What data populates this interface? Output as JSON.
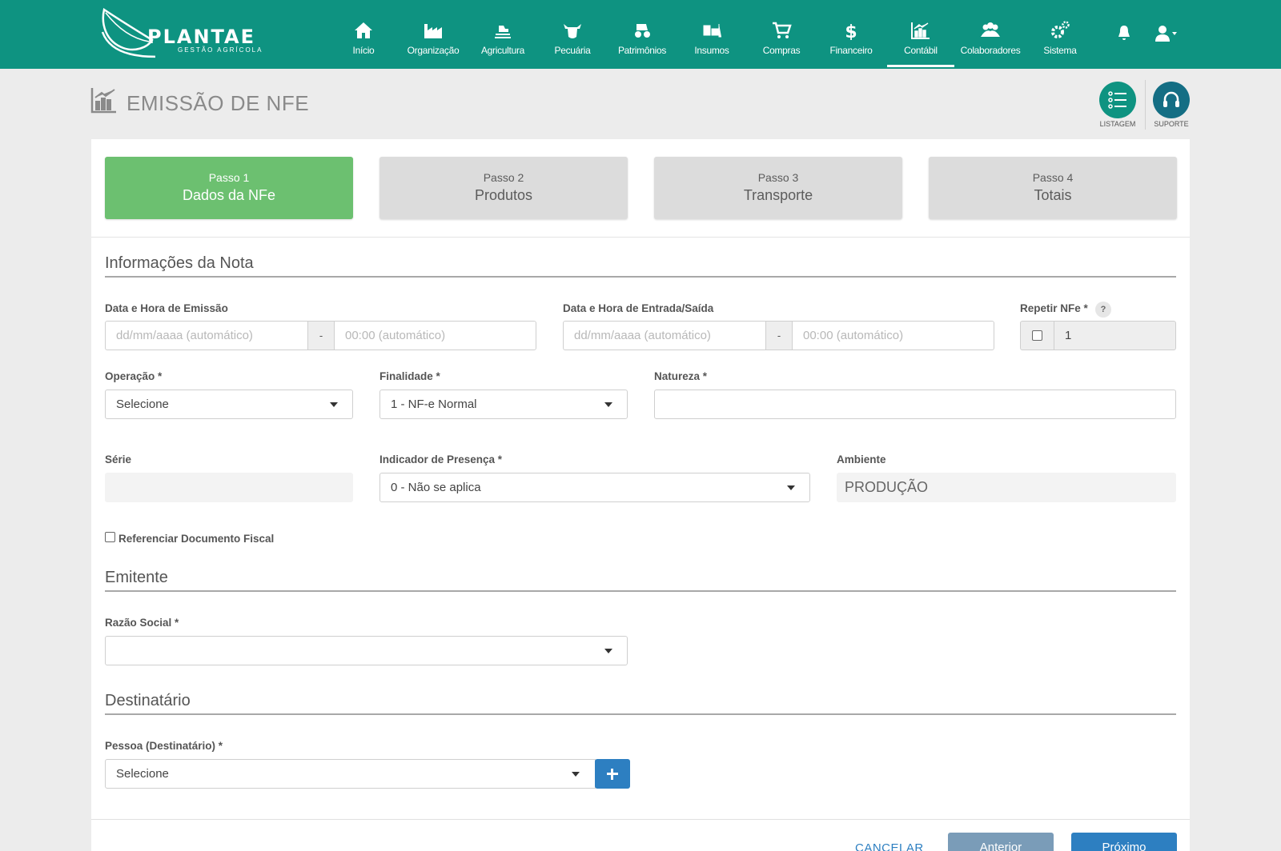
{
  "brand": {
    "name": "PLANTAE",
    "tagline": "GESTÃO AGRÍCOLA"
  },
  "nav": {
    "items": [
      {
        "label": "Início",
        "icon": "home-icon"
      },
      {
        "label": "Organização",
        "icon": "factory-icon"
      },
      {
        "label": "Agricultura",
        "icon": "tractor-field-icon"
      },
      {
        "label": "Pecuária",
        "icon": "cow-icon"
      },
      {
        "label": "Patrimônios",
        "icon": "tractor-icon"
      },
      {
        "label": "Insumos",
        "icon": "forklift-icon"
      },
      {
        "label": "Compras",
        "icon": "cart-icon"
      },
      {
        "label": "Financeiro",
        "icon": "dollar-icon"
      },
      {
        "label": "Contábil",
        "icon": "chart-icon"
      },
      {
        "label": "Colaboradores",
        "icon": "users-icon"
      },
      {
        "label": "Sistema",
        "icon": "gears-icon"
      }
    ],
    "active": "Contábil"
  },
  "page": {
    "title": "EMISSÃO DE NFE",
    "listagem_label": "LISTAGEM",
    "suporte_label": "SUPORTE"
  },
  "steps": [
    {
      "step": "Passo 1",
      "name": "Dados da NFe",
      "active": true
    },
    {
      "step": "Passo 2",
      "name": "Produtos",
      "active": false
    },
    {
      "step": "Passo 3",
      "name": "Transporte",
      "active": false
    },
    {
      "step": "Passo 4",
      "name": "Totais",
      "active": false
    }
  ],
  "info": {
    "section_title": "Informações da Nota",
    "emissao_label": "Data e Hora de Emissão",
    "emissao_date_placeholder": "dd/mm/aaaa (automático)",
    "emissao_time_placeholder": "00:00 (automático)",
    "separator": "-",
    "entrada_label": "Data e Hora de Entrada/Saída",
    "entrada_date_placeholder": "dd/mm/aaaa (automático)",
    "entrada_time_placeholder": "00:00 (automático)",
    "repetir_label": "Repetir NFe *",
    "repetir_help": "?",
    "repetir_value": "1",
    "operacao_label": "Operação *",
    "operacao_value": "Selecione",
    "finalidade_label": "Finalidade *",
    "finalidade_value": "1 - NF-e Normal",
    "natureza_label": "Natureza *",
    "natureza_value": "",
    "serie_label": "Série",
    "serie_value": "",
    "presenca_label": "Indicador de Presença *",
    "presenca_value": "0 - Não se aplica",
    "ambiente_label": "Ambiente",
    "ambiente_value": "PRODUÇÃO",
    "referenciar_label": "Referenciar Documento Fiscal"
  },
  "emitente": {
    "section_title": "Emitente",
    "razao_label": "Razão Social *",
    "razao_value": ""
  },
  "destinatario": {
    "section_title": "Destinatário",
    "pessoa_label": "Pessoa (Destinatário) *",
    "pessoa_value": "Selecione"
  },
  "footer": {
    "cancel_label": "CANCELAR",
    "prev_label": "Anterior",
    "next_label": "Próximo"
  },
  "colors": {
    "navbar": "#0e9381",
    "step_active": "#6cc070",
    "primary": "#2d7fc1",
    "prev_button": "#7a9cb8"
  }
}
